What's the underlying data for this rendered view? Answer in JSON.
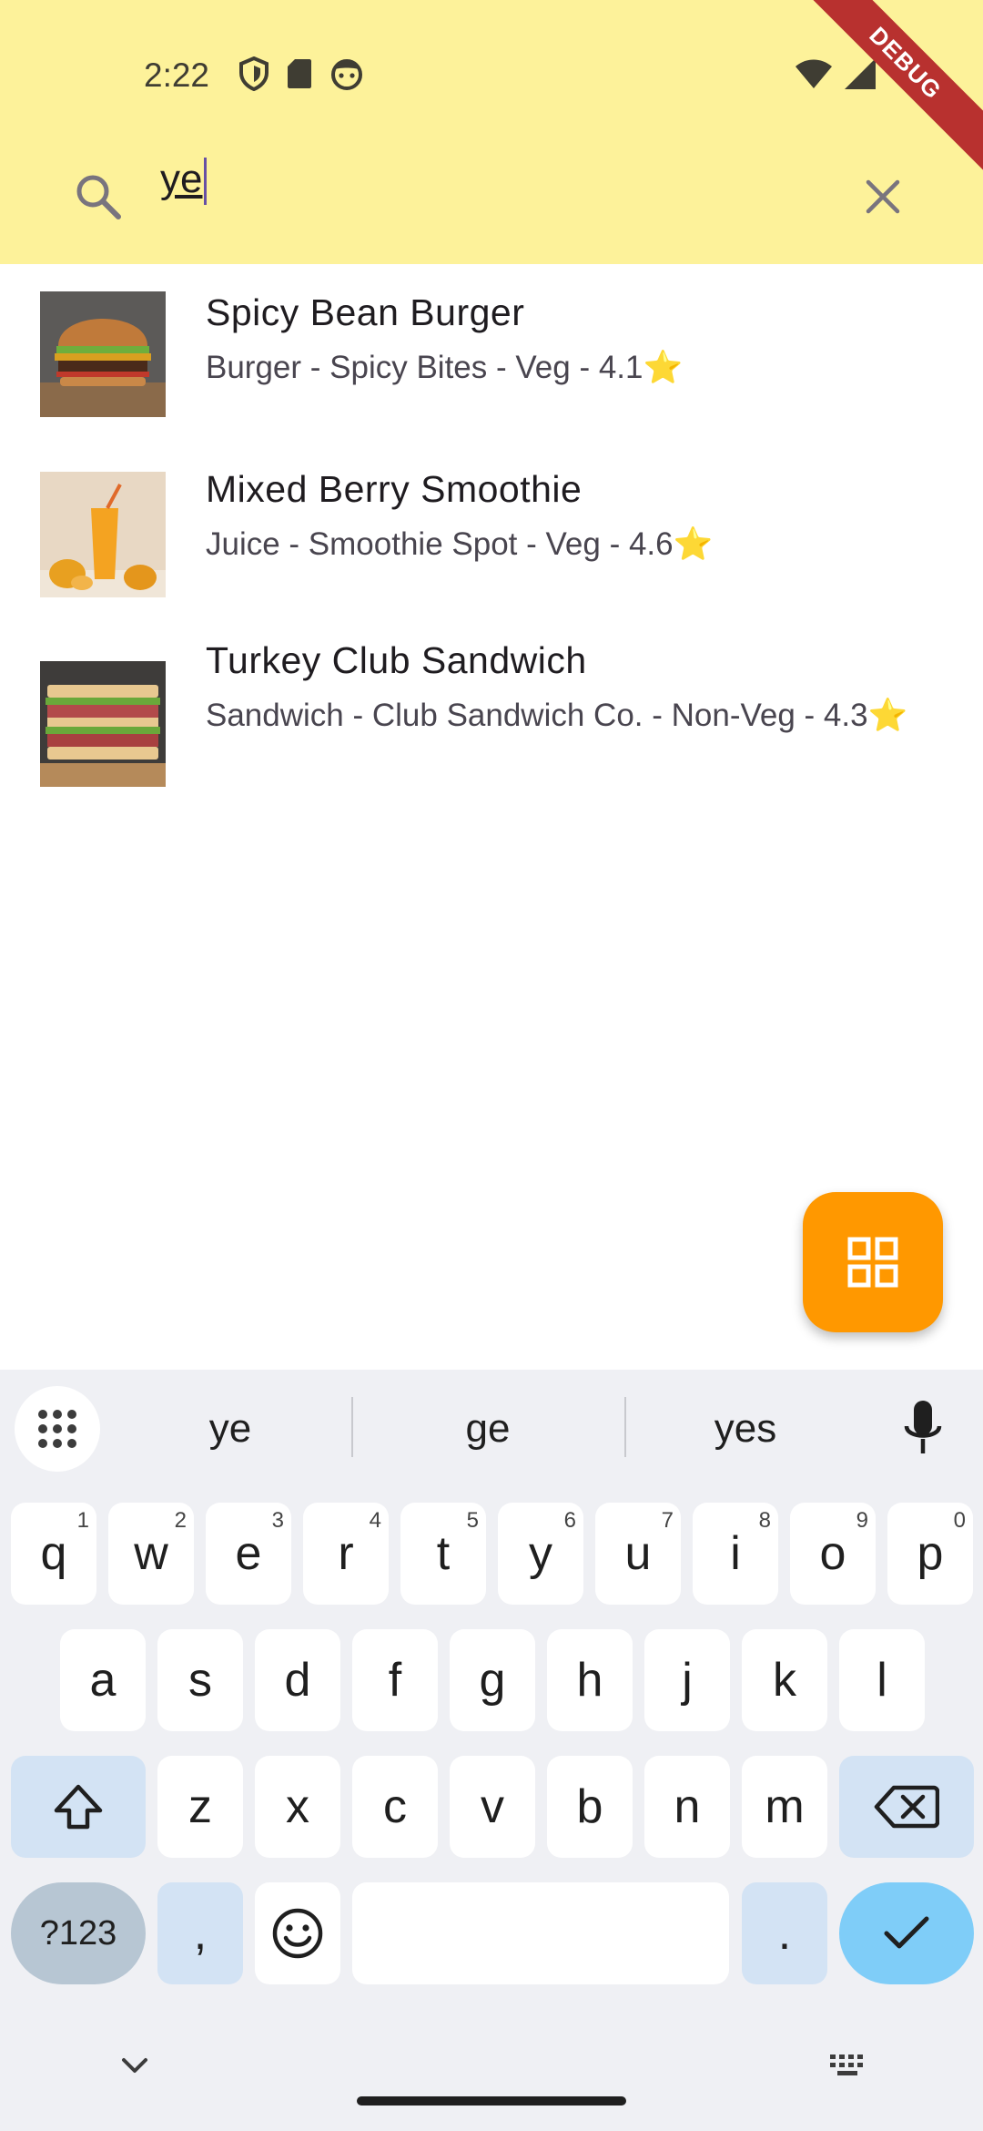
{
  "status_bar": {
    "time": "2:22",
    "icons_left": [
      "shield-icon",
      "sd-card-icon",
      "face-icon"
    ],
    "icons_right": [
      "wifi-icon",
      "signal-icon"
    ],
    "debug_label": "DEBUG"
  },
  "search": {
    "value": "ye",
    "icon": "search-icon",
    "clear_icon": "close-icon"
  },
  "results": [
    {
      "title": "Spicy Bean Burger",
      "subtitle": "Burger - Spicy Bites - Veg - 4.1⭐",
      "image": "burger-image"
    },
    {
      "title": "Mixed Berry Smoothie",
      "subtitle": "Juice - Smoothie Spot - Veg - 4.6⭐",
      "image": "smoothie-image"
    },
    {
      "title": "Turkey Club Sandwich",
      "subtitle": "Sandwich - Club Sandwich Co. - Non-Veg - 4.3⭐",
      "image": "sandwich-image"
    }
  ],
  "fab": {
    "icon": "grid-view-icon",
    "color": "#ff9800"
  },
  "keyboard": {
    "suggestions": [
      "ye",
      "ge",
      "yes"
    ],
    "row1": [
      "q",
      "w",
      "e",
      "r",
      "t",
      "y",
      "u",
      "i",
      "o",
      "p"
    ],
    "row1_hints": [
      "1",
      "2",
      "3",
      "4",
      "5",
      "6",
      "7",
      "8",
      "9",
      "0"
    ],
    "row2": [
      "a",
      "s",
      "d",
      "f",
      "g",
      "h",
      "j",
      "k",
      "l"
    ],
    "row3": [
      "z",
      "x",
      "c",
      "v",
      "b",
      "n",
      "m"
    ],
    "sym_label": "?123",
    "comma": ",",
    "period": "."
  }
}
